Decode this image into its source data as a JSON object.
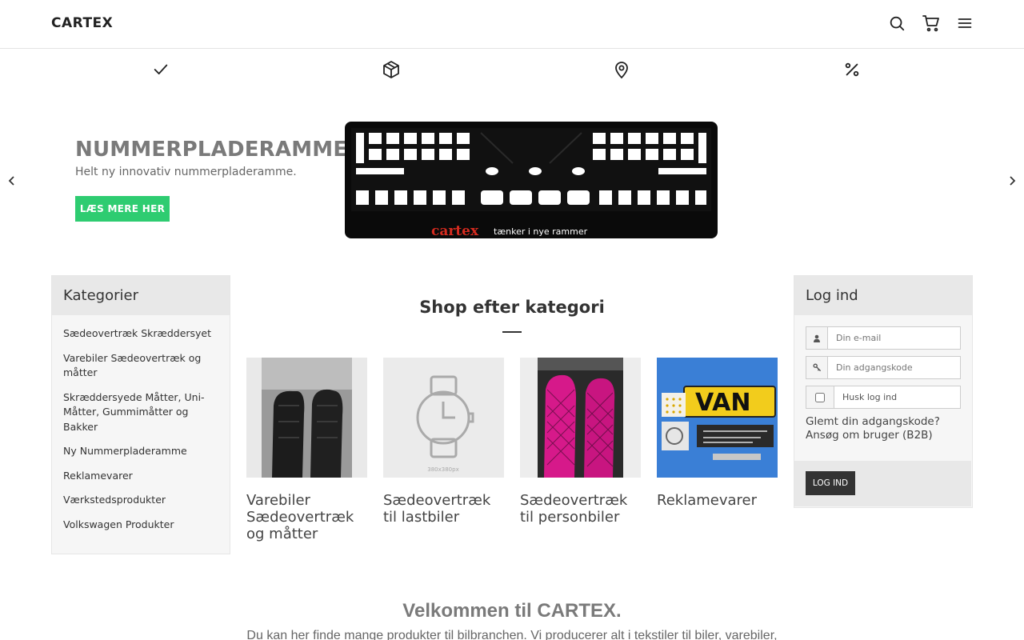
{
  "header": {
    "logo": "CARTEX",
    "icons": [
      "search-icon",
      "cart-icon",
      "menu-icon"
    ]
  },
  "features": [
    "check-icon",
    "package-icon",
    "map-pin-icon",
    "percent-icon"
  ],
  "slider": {
    "title": "NUMMERPLADERAMME",
    "subtitle": "Helt ny innovativ nummerpladeramme.",
    "button": "LÆS MERE HER",
    "image_text": "cartex",
    "image_tagline": "tænker i nye rammer"
  },
  "categories": {
    "title": "Kategorier",
    "items": [
      "Sædeovertræk Skræddersyet",
      "Varebiler Sædeovertræk og måtter",
      "Skræddersyede Måtter, Uni-Måtter, Gummimåtter og Bakker",
      "Ny Nummerpladeramme",
      "Reklamevarer",
      "Værkstedsprodukter",
      "Volkswagen Produkter"
    ]
  },
  "shop": {
    "title": "Shop efter kategori",
    "cards": [
      {
        "label": "Varebiler Sædeovertræk og måtter"
      },
      {
        "label": "Sædeovertræk til lastbiler",
        "placeholder_text": "380x380px"
      },
      {
        "label": "Sædeovertræk til personbiler"
      },
      {
        "label": "Reklamevarer",
        "image_text": "VAN"
      }
    ]
  },
  "login": {
    "title": "Log ind",
    "email_placeholder": "Din e-mail",
    "password_placeholder": "Din adgangskode",
    "remember_label": "Husk log ind",
    "forgot": "Glemt din adgangskode?",
    "apply": "Ansøg om bruger (B2B)",
    "button": "LOG IND"
  },
  "welcome": {
    "title": "Velkommen til CARTEX.",
    "text": "Du kan her finde mange produkter til bilbranchen. Vi producerer alt i tekstiler til biler, varebiler,"
  },
  "colors": {
    "accent_green": "#2ecc71",
    "dark_button": "#333333",
    "panel_bg": "#f6f6f6",
    "panel_head_bg": "#e8e8e8",
    "card_blue": "#3a7fd6",
    "seat_pink": "#d6198a"
  }
}
